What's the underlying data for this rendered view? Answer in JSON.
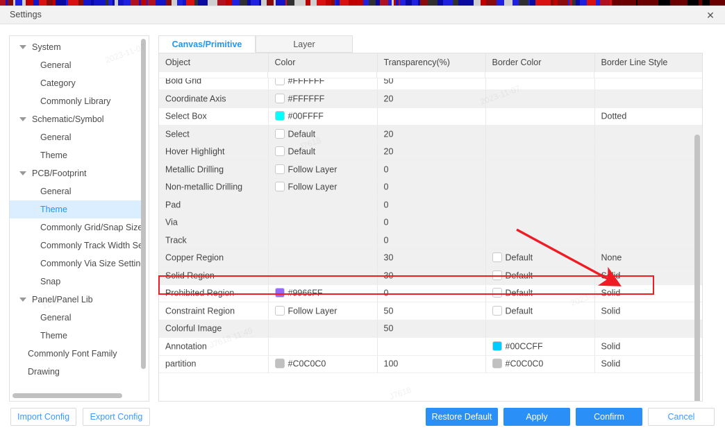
{
  "window": {
    "title": "Settings",
    "close_icon": "close-icon"
  },
  "sidebar": {
    "items": [
      {
        "label": "System",
        "level": "group",
        "expanded": true,
        "selected": false
      },
      {
        "label": "General",
        "level": "child",
        "expanded": false,
        "selected": false
      },
      {
        "label": "Category",
        "level": "child",
        "expanded": false,
        "selected": false
      },
      {
        "label": "Commonly Library",
        "level": "child",
        "expanded": false,
        "selected": false
      },
      {
        "label": "Schematic/Symbol",
        "level": "group",
        "expanded": true,
        "selected": false
      },
      {
        "label": "General",
        "level": "child",
        "expanded": false,
        "selected": false
      },
      {
        "label": "Theme",
        "level": "child",
        "expanded": false,
        "selected": false
      },
      {
        "label": "PCB/Footprint",
        "level": "group",
        "expanded": true,
        "selected": false
      },
      {
        "label": "General",
        "level": "child",
        "expanded": false,
        "selected": false
      },
      {
        "label": "Theme",
        "level": "child",
        "expanded": false,
        "selected": true
      },
      {
        "label": "Commonly Grid/Snap Size S",
        "level": "child",
        "expanded": false,
        "selected": false
      },
      {
        "label": "Commonly Track Width Sett",
        "level": "child",
        "expanded": false,
        "selected": false
      },
      {
        "label": "Commonly Via Size Setting",
        "level": "child",
        "expanded": false,
        "selected": false
      },
      {
        "label": "Snap",
        "level": "child",
        "expanded": false,
        "selected": false
      },
      {
        "label": "Panel/Panel Lib",
        "level": "group",
        "expanded": true,
        "selected": false
      },
      {
        "label": "General",
        "level": "child",
        "expanded": false,
        "selected": false
      },
      {
        "label": "Theme",
        "level": "child",
        "expanded": false,
        "selected": false
      },
      {
        "label": "Commonly Font Family",
        "level": "flat",
        "expanded": false,
        "selected": false
      },
      {
        "label": "Drawing",
        "level": "flat",
        "expanded": false,
        "selected": false
      }
    ]
  },
  "tabs": [
    {
      "label": "Canvas/Primitive",
      "active": true
    },
    {
      "label": "Layer",
      "active": false
    }
  ],
  "table": {
    "columns": [
      "Object",
      "Color",
      "Transparency(%)",
      "Border Color",
      "Border Line Style"
    ],
    "rows": [
      {
        "object": "Bold Grid",
        "color_swatch": "#FFFFFF",
        "color_text": "#FFFFFF",
        "transparency": "50",
        "border_swatch": null,
        "border_text": "",
        "line_style": "",
        "shade": "white",
        "highlight": false
      },
      {
        "object": "Coordinate Axis",
        "color_swatch": "#FFFFFF",
        "color_text": "#FFFFFF",
        "transparency": "20",
        "border_swatch": null,
        "border_text": "",
        "line_style": "",
        "shade": "alt",
        "highlight": false
      },
      {
        "object": "Select Box",
        "color_swatch": "#00FFFF",
        "color_text": "#00FFFF",
        "transparency": "",
        "border_swatch": null,
        "border_text": "",
        "line_style": "Dotted",
        "shade": "white",
        "highlight": false
      },
      {
        "object": "Select",
        "color_swatch": "#FFFFFF",
        "color_text": "Default",
        "transparency": "20",
        "border_swatch": null,
        "border_text": "",
        "line_style": "",
        "shade": "alt",
        "highlight": false
      },
      {
        "object": "Hover Highlight",
        "color_swatch": "#FFFFFF",
        "color_text": "Default",
        "transparency": "20",
        "border_swatch": null,
        "border_text": "",
        "line_style": "",
        "shade": "alt",
        "highlight": false
      },
      {
        "object": "Metallic Drilling",
        "color_swatch": "#FFFFFF",
        "color_text": "Follow Layer",
        "transparency": "0",
        "border_swatch": null,
        "border_text": "",
        "line_style": "",
        "shade": "alt",
        "highlight": false
      },
      {
        "object": "Non-metallic Drilling",
        "color_swatch": "#FFFFFF",
        "color_text": "Follow Layer",
        "transparency": "0",
        "border_swatch": null,
        "border_text": "",
        "line_style": "",
        "shade": "alt",
        "highlight": false
      },
      {
        "object": "Pad",
        "color_swatch": null,
        "color_text": "",
        "transparency": "0",
        "border_swatch": null,
        "border_text": "",
        "line_style": "",
        "shade": "alt",
        "highlight": false
      },
      {
        "object": "Via",
        "color_swatch": null,
        "color_text": "",
        "transparency": "0",
        "border_swatch": null,
        "border_text": "",
        "line_style": "",
        "shade": "alt",
        "highlight": false
      },
      {
        "object": "Track",
        "color_swatch": null,
        "color_text": "",
        "transparency": "0",
        "border_swatch": null,
        "border_text": "",
        "line_style": "",
        "shade": "alt",
        "highlight": false
      },
      {
        "object": "Copper Region",
        "color_swatch": null,
        "color_text": "",
        "transparency": "30",
        "border_swatch": "#FFFFFF",
        "border_text": "Default",
        "line_style": "None",
        "shade": "alt",
        "highlight": true
      },
      {
        "object": "Solid Region",
        "color_swatch": null,
        "color_text": "",
        "transparency": "30",
        "border_swatch": "#FFFFFF",
        "border_text": "Default",
        "line_style": "Solid",
        "shade": "alt",
        "highlight": false
      },
      {
        "object": "Prohibited Region",
        "color_swatch": "#9966FF",
        "color_text": "#9966FF",
        "transparency": "0",
        "border_swatch": "#FFFFFF",
        "border_text": "Default",
        "line_style": "Solid",
        "shade": "white",
        "highlight": false
      },
      {
        "object": "Constraint Region",
        "color_swatch": "#FFFFFF",
        "color_text": "Follow Layer",
        "transparency": "50",
        "border_swatch": "#FFFFFF",
        "border_text": "Default",
        "line_style": "Solid",
        "shade": "white",
        "highlight": false
      },
      {
        "object": "Colorful Image",
        "color_swatch": null,
        "color_text": "",
        "transparency": "50",
        "border_swatch": null,
        "border_text": "",
        "line_style": "",
        "shade": "alt",
        "highlight": false
      },
      {
        "object": "Annotation",
        "color_swatch": null,
        "color_text": "",
        "transparency": "",
        "border_swatch": "#00CCFF",
        "border_text": "#00CCFF",
        "line_style": "Solid",
        "shade": "white",
        "highlight": false
      },
      {
        "object": "partition",
        "color_swatch": "#C0C0C0",
        "color_text": "#C0C0C0",
        "transparency": "100",
        "border_swatch": "#C0C0C0",
        "border_text": "#C0C0C0",
        "line_style": "Solid",
        "shade": "white",
        "highlight": false
      }
    ]
  },
  "footer": {
    "import_label": "Import Config",
    "export_label": "Export Config",
    "restore_label": "Restore Default",
    "apply_label": "Apply",
    "confirm_label": "Confirm",
    "cancel_label": "Cancel"
  },
  "annotations": {
    "highlight_color": "#EE1C25",
    "arrow_color": "#EE1C25",
    "highlight_target": "Copper Region",
    "arrow_points_to": "None"
  },
  "theme": {
    "accent": "#2A8FF7",
    "selected_row_bg": "#DBEEFF",
    "header_bg": "#F0F0F0"
  }
}
